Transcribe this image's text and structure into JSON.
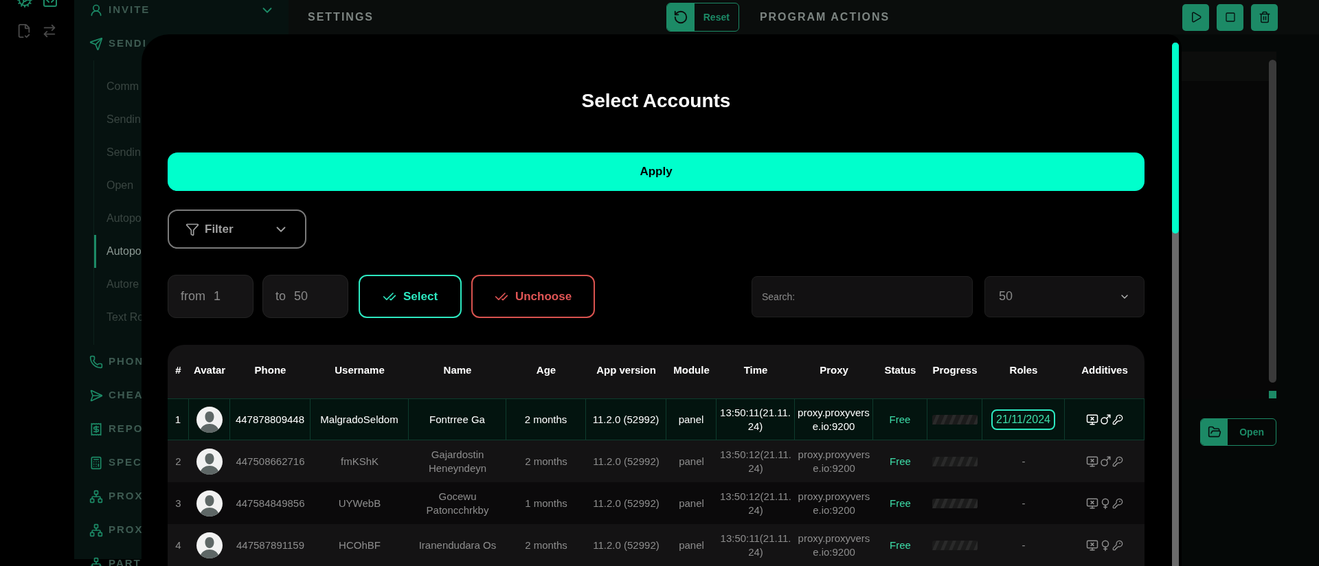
{
  "sidebar": {
    "sections": [
      {
        "label": "INVITE"
      },
      {
        "label": "SENDI",
        "children": [
          {
            "label": "Comm",
            "selected": false
          },
          {
            "label": "Sendin",
            "selected": false
          },
          {
            "label": "Sendin",
            "selected": false
          },
          {
            "label": "Open",
            "selected": false
          },
          {
            "label": "Autopo",
            "selected": false
          },
          {
            "label": "Autopo",
            "selected": true
          },
          {
            "label": "Autore",
            "selected": false
          },
          {
            "label": "Text Ro",
            "selected": false
          }
        ]
      },
      {
        "label": "PHON"
      },
      {
        "label": "CHEA"
      },
      {
        "label": "REPO"
      },
      {
        "label": "SPEC"
      },
      {
        "label": "PROX"
      },
      {
        "label": "PROX"
      },
      {
        "label": "PART"
      }
    ]
  },
  "settings_panel": {
    "title": "SETTINGS",
    "reset_button": "Reset"
  },
  "actions_panel": {
    "title": "PROGRAM ACTIONS",
    "open_button": "Open"
  },
  "modal": {
    "title": "Select Accounts",
    "apply_button": "Apply",
    "filter_button": "Filter",
    "from_field": {
      "label": "from",
      "value": "1"
    },
    "to_field": {
      "label": "to",
      "value": "50"
    },
    "select_button": "Select",
    "unchoose_button": "Unchoose",
    "search": {
      "placeholder": "Search:"
    },
    "page_size": "50",
    "table": {
      "columns": [
        "#",
        "Avatar",
        "Phone",
        "Username",
        "Name",
        "Age",
        "App version",
        "Module",
        "Time",
        "Proxy",
        "Status",
        "Progress",
        "Roles",
        "Additives"
      ],
      "rows": [
        {
          "index": "1",
          "phone": "447878809448",
          "username": "MalgradoSeldom",
          "name": "Fontrree Ga",
          "age": "2 months",
          "app_version": "11.2.0 (52992)",
          "module": "panel",
          "time": "13:50:11(21.11.24)",
          "proxy": "proxy.proxyverse.io:9200",
          "status": "Free",
          "roles": {
            "kind": "badge",
            "text": "21/11/2024"
          },
          "male": true,
          "selected": true
        },
        {
          "index": "2",
          "phone": "447508662716",
          "username": "fmKShK",
          "name": "Gajardostin Heneyndeyn",
          "age": "2 months",
          "app_version": "11.2.0 (52992)",
          "module": "panel",
          "time": "13:50:12(21.11.24)",
          "proxy": "proxy.proxyverse.io:9200",
          "status": "Free",
          "roles": {
            "kind": "plain",
            "text": "-"
          },
          "male": true,
          "selected": false
        },
        {
          "index": "3",
          "phone": "447584849856",
          "username": "UYWebB",
          "name": "Gocewu Patoncchrkby",
          "age": "1 months",
          "app_version": "11.2.0 (52992)",
          "module": "panel",
          "time": "13:50:12(21.11.24)",
          "proxy": "proxy.proxyverse.io:9200",
          "status": "Free",
          "roles": {
            "kind": "plain",
            "text": "-"
          },
          "male": false,
          "selected": false
        },
        {
          "index": "4",
          "phone": "447587891159",
          "username": "HCOhBF",
          "name": "Iranendudara Os",
          "age": "2 months",
          "app_version": "11.2.0 (52992)",
          "module": "panel",
          "time": "13:50:11(21.11.24)",
          "proxy": "proxy.proxyverse.io:9200",
          "status": "Free",
          "roles": {
            "kind": "plain",
            "text": "-"
          },
          "male": false,
          "selected": false
        }
      ]
    }
  }
}
